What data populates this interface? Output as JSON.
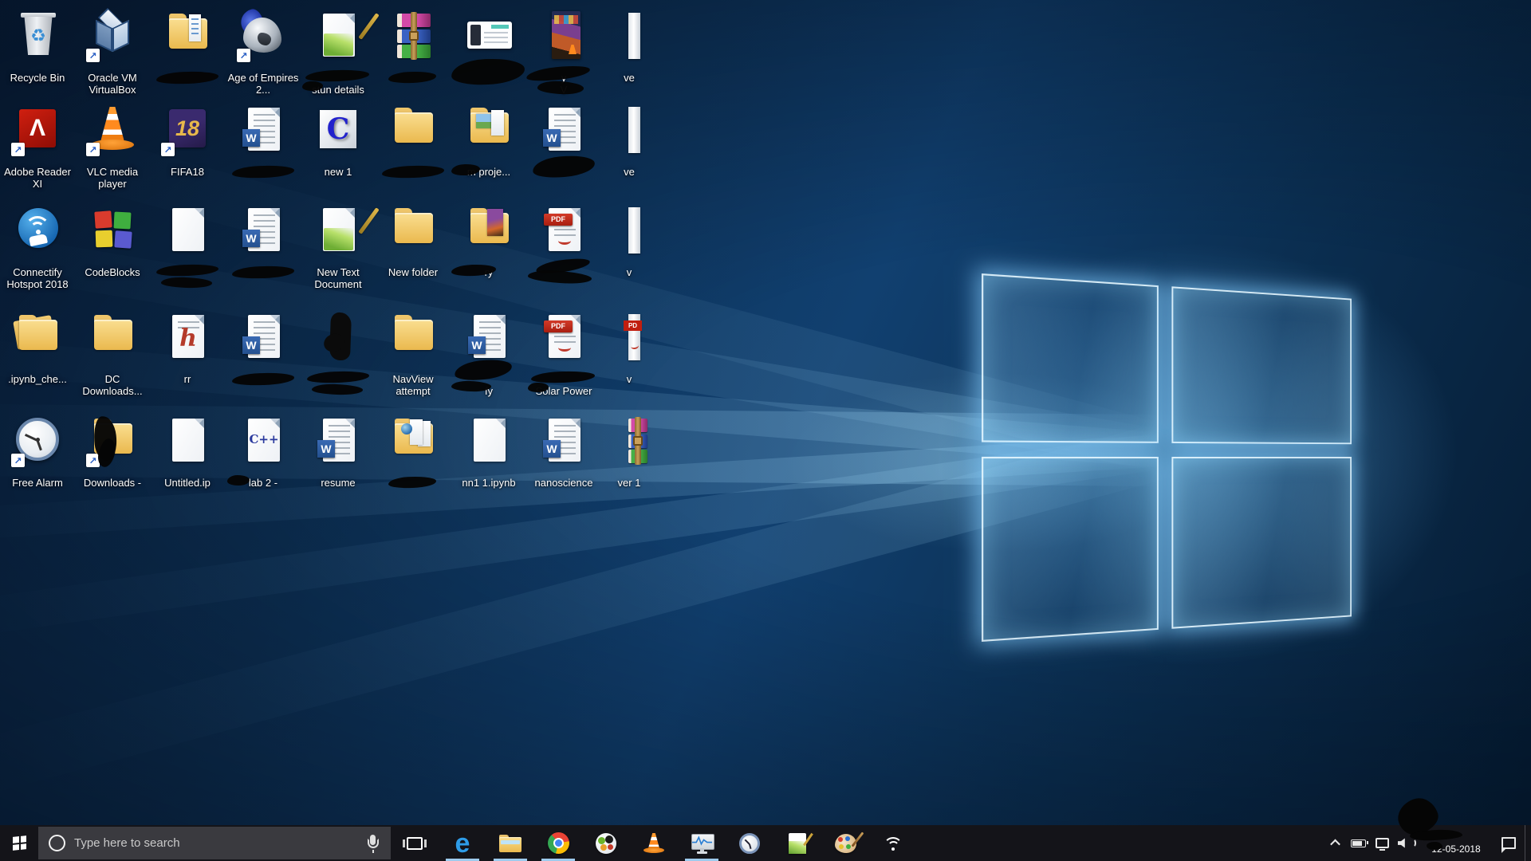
{
  "wallpaper": {
    "base_color": "#0d3156",
    "glow_color": "#7fd4ff",
    "logo": "windows-10-hero"
  },
  "icon_text": {
    "word_badge": "W",
    "fifa": "18",
    "cdoc": "C",
    "cpp": "C++",
    "pdf": "PDF",
    "pdf_small": "PD",
    "hdoc": "h",
    "adobe": "Λ",
    "recycle": "♻",
    "edge": "e",
    "shortcut_arrow": "↗"
  },
  "desktop": {
    "icons": [
      {
        "name": "recycle-bin",
        "type": "recycle",
        "label": "Recycle Bin",
        "row": 1,
        "col": 1
      },
      {
        "name": "oracle-vm-virtualbox",
        "type": "vbox",
        "label": "Oracle VM VirtualBox",
        "row": 1,
        "col": 2,
        "shortcut": true
      },
      {
        "name": "folder-redacted-1",
        "type": "folder-docs",
        "label": "",
        "row": 1,
        "col": 3,
        "censor": "label"
      },
      {
        "name": "age-of-empires-2",
        "type": "aoe",
        "label": "Age of Empires 2...",
        "row": 1,
        "col": 4,
        "shortcut": true
      },
      {
        "name": "doc-stun-details",
        "type": "npp-doc",
        "label": "stun details",
        "row": 1,
        "col": 5,
        "censor": "line1",
        "line2": true
      },
      {
        "name": "rar-redacted",
        "type": "winrar",
        "label": "",
        "row": 1,
        "col": 6,
        "censor": "label-small"
      },
      {
        "name": "screenshot-redacted",
        "type": "screenshot",
        "label": "",
        "row": 1,
        "col": 7,
        "censor": "blob"
      },
      {
        "name": "game-redacted",
        "type": "gamebox",
        "label": "y",
        "label2": "V",
        "row": 1,
        "col": 8,
        "censor": "game"
      },
      {
        "name": "doc-ve-1",
        "type": "sliver",
        "label": "ve",
        "row": 1,
        "col": 9
      },
      {
        "name": "adobe-reader-xi",
        "type": "adobe",
        "label": "Adobe Reader XI",
        "row": 2,
        "col": 1,
        "shortcut": true
      },
      {
        "name": "vlc-media-player",
        "type": "vlccone",
        "label": "VLC media player",
        "row": 2,
        "col": 2,
        "shortcut": true
      },
      {
        "name": "fifa18",
        "type": "fifa",
        "label": "FIFA18",
        "row": 2,
        "col": 3,
        "shortcut": true
      },
      {
        "name": "word-redacted-1",
        "type": "word",
        "label": "",
        "row": 2,
        "col": 4,
        "censor": "label"
      },
      {
        "name": "new-1",
        "type": "cdoc",
        "label": "new 1",
        "row": 2,
        "col": 5
      },
      {
        "name": "folder-redacted-2",
        "type": "folder",
        "label": "",
        "row": 2,
        "col": 6,
        "censor": "label"
      },
      {
        "name": "folder-proje",
        "type": "folder-pic",
        "label": "m proje...",
        "row": 2,
        "col": 7,
        "censor": "left"
      },
      {
        "name": "word-redacted-2",
        "type": "word",
        "label": "",
        "row": 2,
        "col": 8,
        "censor": "blob-small"
      },
      {
        "name": "doc-ve-2",
        "type": "sliver",
        "label": "ve",
        "row": 2,
        "col": 9
      },
      {
        "name": "connectify-hotspot-2018",
        "type": "connectify",
        "label": "Connectify Hotspot 2018",
        "row": 3,
        "col": 1
      },
      {
        "name": "codeblocks",
        "type": "codeblocks",
        "label": "CodeBlocks",
        "row": 3,
        "col": 2
      },
      {
        "name": "paper-redacted",
        "type": "paper",
        "label": "",
        "row": 3,
        "col": 3,
        "censor": "label2"
      },
      {
        "name": "word-redacted-3",
        "type": "word",
        "label": "",
        "row": 3,
        "col": 4,
        "censor": "label"
      },
      {
        "name": "new-text-document",
        "type": "npp-doc",
        "label": "New Text Document",
        "row": 3,
        "col": 5
      },
      {
        "name": "new-folder",
        "type": "folder",
        "label": "New folder",
        "row": 3,
        "col": 6
      },
      {
        "name": "folder-ry",
        "type": "folder-book",
        "label": "ry",
        "row": 3,
        "col": 7,
        "censor": "left-wide"
      },
      {
        "name": "pdf-redacted-1",
        "type": "pdf",
        "label": "",
        "row": 3,
        "col": 8,
        "censor": "curve"
      },
      {
        "name": "doc-v-1",
        "type": "sliver",
        "label": "v",
        "row": 3,
        "col": 9
      },
      {
        "name": "ipynb-checkpoints",
        "type": "folder-open",
        "label": ".ipynb_che...",
        "row": 4,
        "col": 1
      },
      {
        "name": "dc-downloads",
        "type": "folder",
        "label": "DC Downloads...",
        "row": 4,
        "col": 2
      },
      {
        "name": "rr",
        "type": "hdoc",
        "label": "rr",
        "row": 4,
        "col": 3
      },
      {
        "name": "word-redacted-4",
        "type": "word",
        "label": "",
        "row": 4,
        "col": 4,
        "censor": "label"
      },
      {
        "name": "icon-redacted",
        "type": "blackicon",
        "label": "",
        "row": 4,
        "col": 5,
        "censor": "label2"
      },
      {
        "name": "navview-attempt",
        "type": "folder",
        "label": "NavView attempt",
        "row": 4,
        "col": 6
      },
      {
        "name": "word-fy",
        "type": "word",
        "label": "fy",
        "row": 4,
        "col": 7,
        "censor": "fy",
        "line2": true
      },
      {
        "name": "solar-power",
        "type": "pdf",
        "label": "Solar Power",
        "row": 4,
        "col": 8,
        "censor": "line1",
        "line2": true
      },
      {
        "name": "pdf-v",
        "type": "sliver-pdf",
        "label": "v",
        "row": 4,
        "col": 9
      },
      {
        "name": "free-alarm",
        "type": "clock",
        "label": "Free Alarm",
        "row": 5,
        "col": 1,
        "shortcut": true
      },
      {
        "name": "downloads",
        "type": "folder",
        "label": "Downloads -",
        "row": 5,
        "col": 2,
        "shortcut": true,
        "censor": "icon"
      },
      {
        "name": "untitled-ipynb",
        "type": "paper",
        "label": "Untitled.ip",
        "row": 5,
        "col": 3
      },
      {
        "name": "lab-2",
        "type": "cppdoc",
        "label": "lab 2 -",
        "row": 5,
        "col": 4,
        "censor": "left-small"
      },
      {
        "name": "resume",
        "type": "word",
        "label": "resume",
        "row": 5,
        "col": 5
      },
      {
        "name": "folder-redacted-3",
        "type": "folder-globe",
        "label": "",
        "row": 5,
        "col": 6,
        "censor": "label-small"
      },
      {
        "name": "nn1-ipynb",
        "type": "paper",
        "label": "nn1 1.ipynb",
        "row": 5,
        "col": 7
      },
      {
        "name": "nanoscience",
        "type": "word",
        "label": "nanoscience",
        "row": 5,
        "col": 8
      },
      {
        "name": "ver-1",
        "type": "winrar",
        "label": "ver 1",
        "row": 5,
        "col": 9
      }
    ]
  },
  "taskbar": {
    "search_placeholder": "Type here to search",
    "apps": [
      {
        "name": "task-view",
        "open": false
      },
      {
        "name": "edge",
        "open": true
      },
      {
        "name": "file-explorer",
        "open": true
      },
      {
        "name": "chrome",
        "open": true
      },
      {
        "name": "photoscape",
        "open": false
      },
      {
        "name": "vlc",
        "open": false
      },
      {
        "name": "system-monitor",
        "open": true
      },
      {
        "name": "alarm-clock",
        "open": false
      },
      {
        "name": "notepad-plus-plus",
        "open": false
      },
      {
        "name": "paint-palette",
        "open": false
      },
      {
        "name": "wifi-hotspot",
        "open": false
      }
    ],
    "tray": {
      "date": "12-05-2018"
    }
  }
}
